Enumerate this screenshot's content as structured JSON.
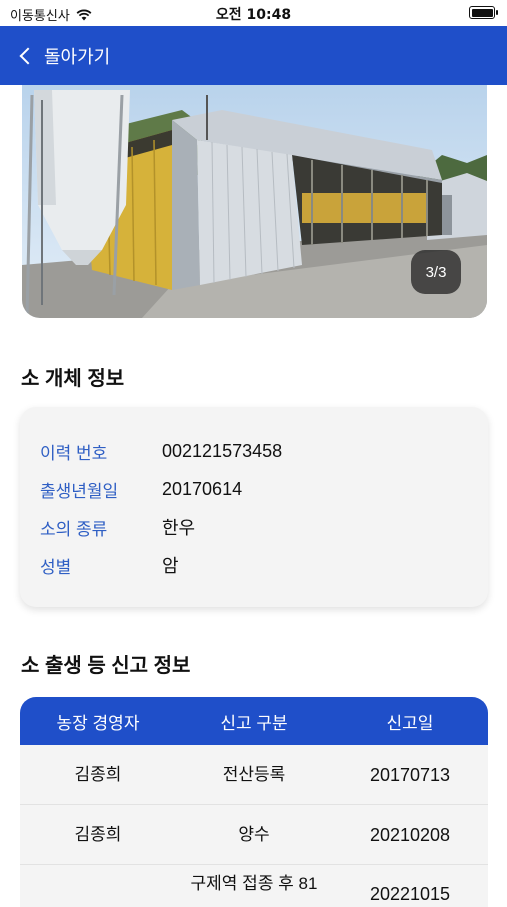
{
  "status_bar": {
    "carrier": "이동통신사",
    "time": "오전 10:48"
  },
  "nav": {
    "back_label": "돌아가기"
  },
  "photo": {
    "counter": "3/3"
  },
  "cattle_info": {
    "title": "소 개체 정보",
    "rows": [
      {
        "label": "이력 번호",
        "value": "002121573458"
      },
      {
        "label": "출생년월일",
        "value": "20170614"
      },
      {
        "label": "소의 종류",
        "value": "한우"
      },
      {
        "label": "성별",
        "value": "암"
      }
    ]
  },
  "report_info": {
    "title": "소 출생 등 신고 정보",
    "columns": [
      "농장 경영자",
      "신고 구분",
      "신고일"
    ],
    "rows": [
      {
        "owner": "김종희",
        "type": "전산등록",
        "date": "20170713"
      },
      {
        "owner": "김종희",
        "type": "양수",
        "date": "20210208"
      },
      {
        "owner": "",
        "type": "구제역 접종 후 81",
        "date": "20221015"
      }
    ]
  },
  "colors": {
    "brand_blue": "#1f4fc9",
    "label_blue": "#2f5fc4",
    "card_bg": "#f4f4f4"
  }
}
